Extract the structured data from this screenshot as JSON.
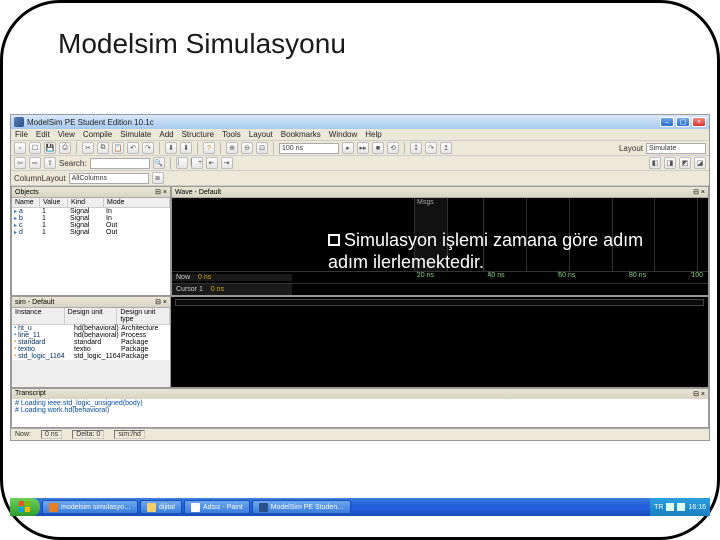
{
  "slide": {
    "title": "Modelsim Simulasyonu"
  },
  "callout": {
    "text": "Simulasyon işlemi zamana göre adım adım ilerlemektedir."
  },
  "titlebar": {
    "title": "ModelSim PE Student Edition 10.1c"
  },
  "menu": [
    "File",
    "Edit",
    "View",
    "Compile",
    "Simulate",
    "Add",
    "Structure",
    "Tools",
    "Layout",
    "Bookmarks",
    "Window",
    "Help"
  ],
  "toolbar2": {
    "search_label": "Search:",
    "column_layout_label": "ColumnLayout",
    "column_layout_value": "AllColumns",
    "layout_label": "Layout",
    "layout_value": "Simulate"
  },
  "objects": {
    "title": "Objects",
    "cols": [
      "Name",
      "Value",
      "Kind",
      "Mode"
    ],
    "rows": [
      {
        "name": "a",
        "value": "1",
        "kind": "Signal",
        "mode": "In"
      },
      {
        "name": "b",
        "value": "1",
        "kind": "Signal",
        "mode": "In"
      },
      {
        "name": "c",
        "value": "1",
        "kind": "Signal",
        "mode": "Out"
      },
      {
        "name": "d",
        "value": "1",
        "kind": "Signal",
        "mode": "Out"
      }
    ]
  },
  "wave": {
    "title": "Wave - Default",
    "msgs": "Msgs",
    "now_label": "Now",
    "now_value": "0 ns",
    "cursor_label": "Cursor 1",
    "cursor_value": "0 ns",
    "ticks": [
      "20 ns",
      "40 ns",
      "60 ns",
      "80 ns",
      "100"
    ]
  },
  "sim": {
    "title": "sim - Default",
    "cols": [
      "Instance",
      "Design unit",
      "Design unit type"
    ],
    "rows": [
      {
        "name": "ht_u",
        "unit": "hd(behavioral)",
        "type": "Architecture"
      },
      {
        "name": "line_11",
        "unit": "hd(behavioral)",
        "type": "Process"
      },
      {
        "name": "standard",
        "unit": "standard",
        "type": "Package"
      },
      {
        "name": "textio",
        "unit": "textio",
        "type": "Package"
      },
      {
        "name": "std_logic_1164",
        "unit": "std_logic_1164",
        "type": "Package"
      }
    ]
  },
  "transcript": {
    "title": "Transcript",
    "lines": [
      "Loading ieee.std_logic_unsigned(body)",
      "Loading work.hd(behavioral)"
    ]
  },
  "status": {
    "now_label": "Now:",
    "now_value": "0 ns",
    "delta_label": "Delta: 0",
    "sim_label": "sim:/hd"
  },
  "taskbar": {
    "items": [
      {
        "label": "modelsim simulasyo…"
      },
      {
        "label": "dijital"
      },
      {
        "label": "Adsız - Paint"
      },
      {
        "label": "ModelSim PE Studen…"
      }
    ],
    "tray_label": "TR",
    "time": "16:16"
  }
}
